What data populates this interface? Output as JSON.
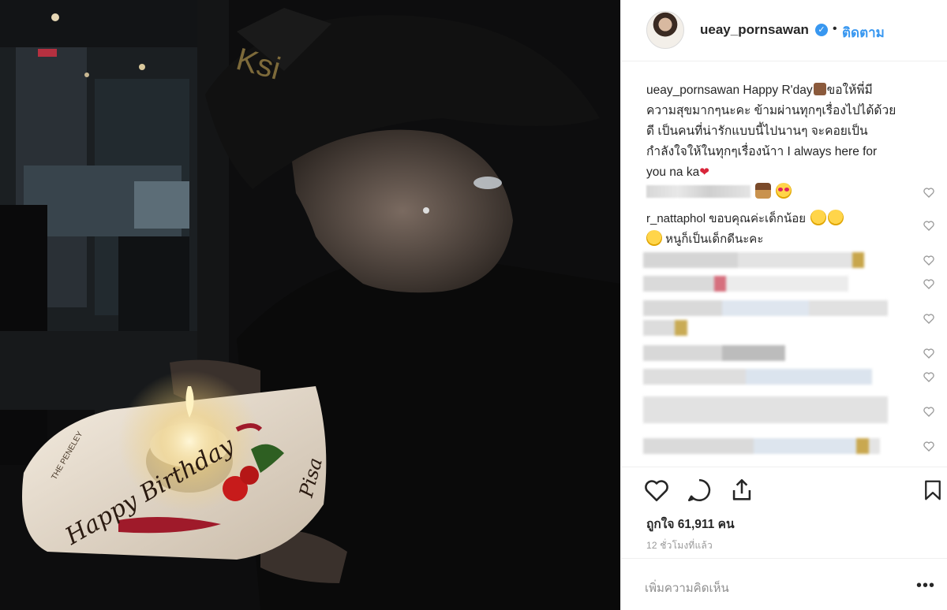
{
  "header": {
    "username": "ueay_pornsawan",
    "verified_mark": "✓",
    "separator": "•",
    "follow_label": "ติดตาม"
  },
  "caption": {
    "username": "ueay_pornsawan",
    "line1": "Happy R'day",
    "line1b": "ขอให้พี่มี",
    "line2": "ความสุขมากๆนะคะ ข้ามผ่านทุกๆเรื่องไปได้ด้วย",
    "line3": "ดี เป็นคนที่น่ารักแบบนี้ไปนานๆ จะคอยเป็น",
    "line4": "กำลังใจให้ในทุกๆเรื่องน้าา I always here for",
    "line5": "you na ka"
  },
  "comments": [
    {
      "username": "",
      "text": ""
    },
    {
      "username": "r_nattaphol",
      "text": "ขอบคุณค่ะเด็กน้อย",
      "text2": "หนูก็เป็นเด็กดีนะคะ"
    }
  ],
  "actions": {
    "like_icon": "heart-outline-icon",
    "comment_icon": "comment-bubble-icon",
    "share_icon": "share-upload-icon",
    "save_icon": "bookmark-icon"
  },
  "likes_text": "ถูกใจ 61,911 คน",
  "time_ago": "12 ชั่วโมงที่แล้ว",
  "add_comment_placeholder": "เพิ่มความคิดเห็น",
  "more_label": "•••",
  "colors": {
    "accent": "#3897f0",
    "text": "#262626",
    "muted": "#999999",
    "border": "#efefef"
  }
}
